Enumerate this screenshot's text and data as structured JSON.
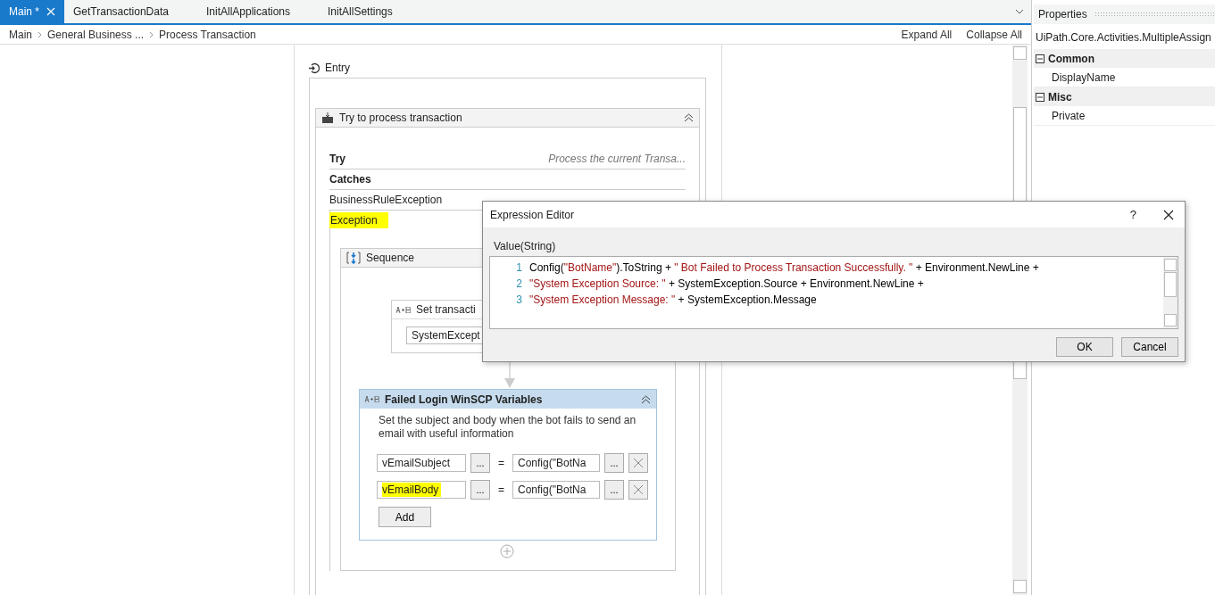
{
  "tabs": [
    {
      "label": "Main *",
      "selected": true,
      "closable": true
    },
    {
      "label": "GetTransactionData",
      "selected": false,
      "closable": false
    },
    {
      "label": "InitAllApplications",
      "selected": false,
      "closable": false
    },
    {
      "label": "InitAllSettings",
      "selected": false,
      "closable": false
    }
  ],
  "breadcrumb": [
    "Main",
    "General Business ...",
    "Process Transaction"
  ],
  "toolbar_links": [
    "Expand All",
    "Collapse All"
  ],
  "designer": {
    "entry": "Entry",
    "try_catch": {
      "title": "Try to process transaction",
      "try_label": "Try",
      "try_description": "Process the current Transa...",
      "catches_label": "Catches",
      "catches": [
        {
          "exception": "BusinessRuleException",
          "highlighted": false
        },
        {
          "exception": "Exception",
          "highlighted": true
        }
      ]
    },
    "sequence": {
      "title": "Sequence",
      "set_activity": {
        "title": "Set transacti",
        "field": "SystemExcept"
      },
      "assign": {
        "title": "Failed Login WinSCP Variables",
        "annotation": "Set the subject and body when the bot fails to send an email with useful information",
        "rows": [
          {
            "to": "vEmailSubject",
            "value": "Config(\"BotNa",
            "highlighted": false
          },
          {
            "to": "vEmailBody",
            "value": "Config(\"BotNa",
            "highlighted": true
          }
        ],
        "add_button": "Add",
        "browse": "...",
        "equals": "="
      }
    }
  },
  "properties": {
    "title": "Properties",
    "type": "UiPath.Core.Activities.MultipleAssign",
    "categories": [
      {
        "name": "Common",
        "expanded": true,
        "properties": [
          "DisplayName"
        ]
      },
      {
        "name": "Misc",
        "expanded": true,
        "properties": [
          "Private"
        ]
      }
    ]
  },
  "dialog": {
    "title": "Expression Editor",
    "help": "?",
    "label": "Value(String)",
    "lines": [
      {
        "number": "1",
        "tokens": [
          {
            "kind": "code",
            "text": "Config("
          },
          {
            "kind": "string",
            "text": "\"BotName\""
          },
          {
            "kind": "code",
            "text": ").ToString + "
          },
          {
            "kind": "string",
            "text": "\" Bot Failed to Process Transaction Successfully. \""
          },
          {
            "kind": "code",
            "text": " + Environment.NewLine +"
          }
        ]
      },
      {
        "number": "2",
        "tokens": [
          {
            "kind": "string",
            "text": "\"System Exception Source: \""
          },
          {
            "kind": "code",
            "text": " + SystemException.Source + Environment.NewLine +"
          }
        ]
      },
      {
        "number": "3",
        "tokens": [
          {
            "kind": "string",
            "text": "\"System Exception Message: \""
          },
          {
            "kind": "code",
            "text": " + SystemException.Message"
          }
        ]
      }
    ],
    "buttons": [
      "OK",
      "Cancel"
    ]
  }
}
